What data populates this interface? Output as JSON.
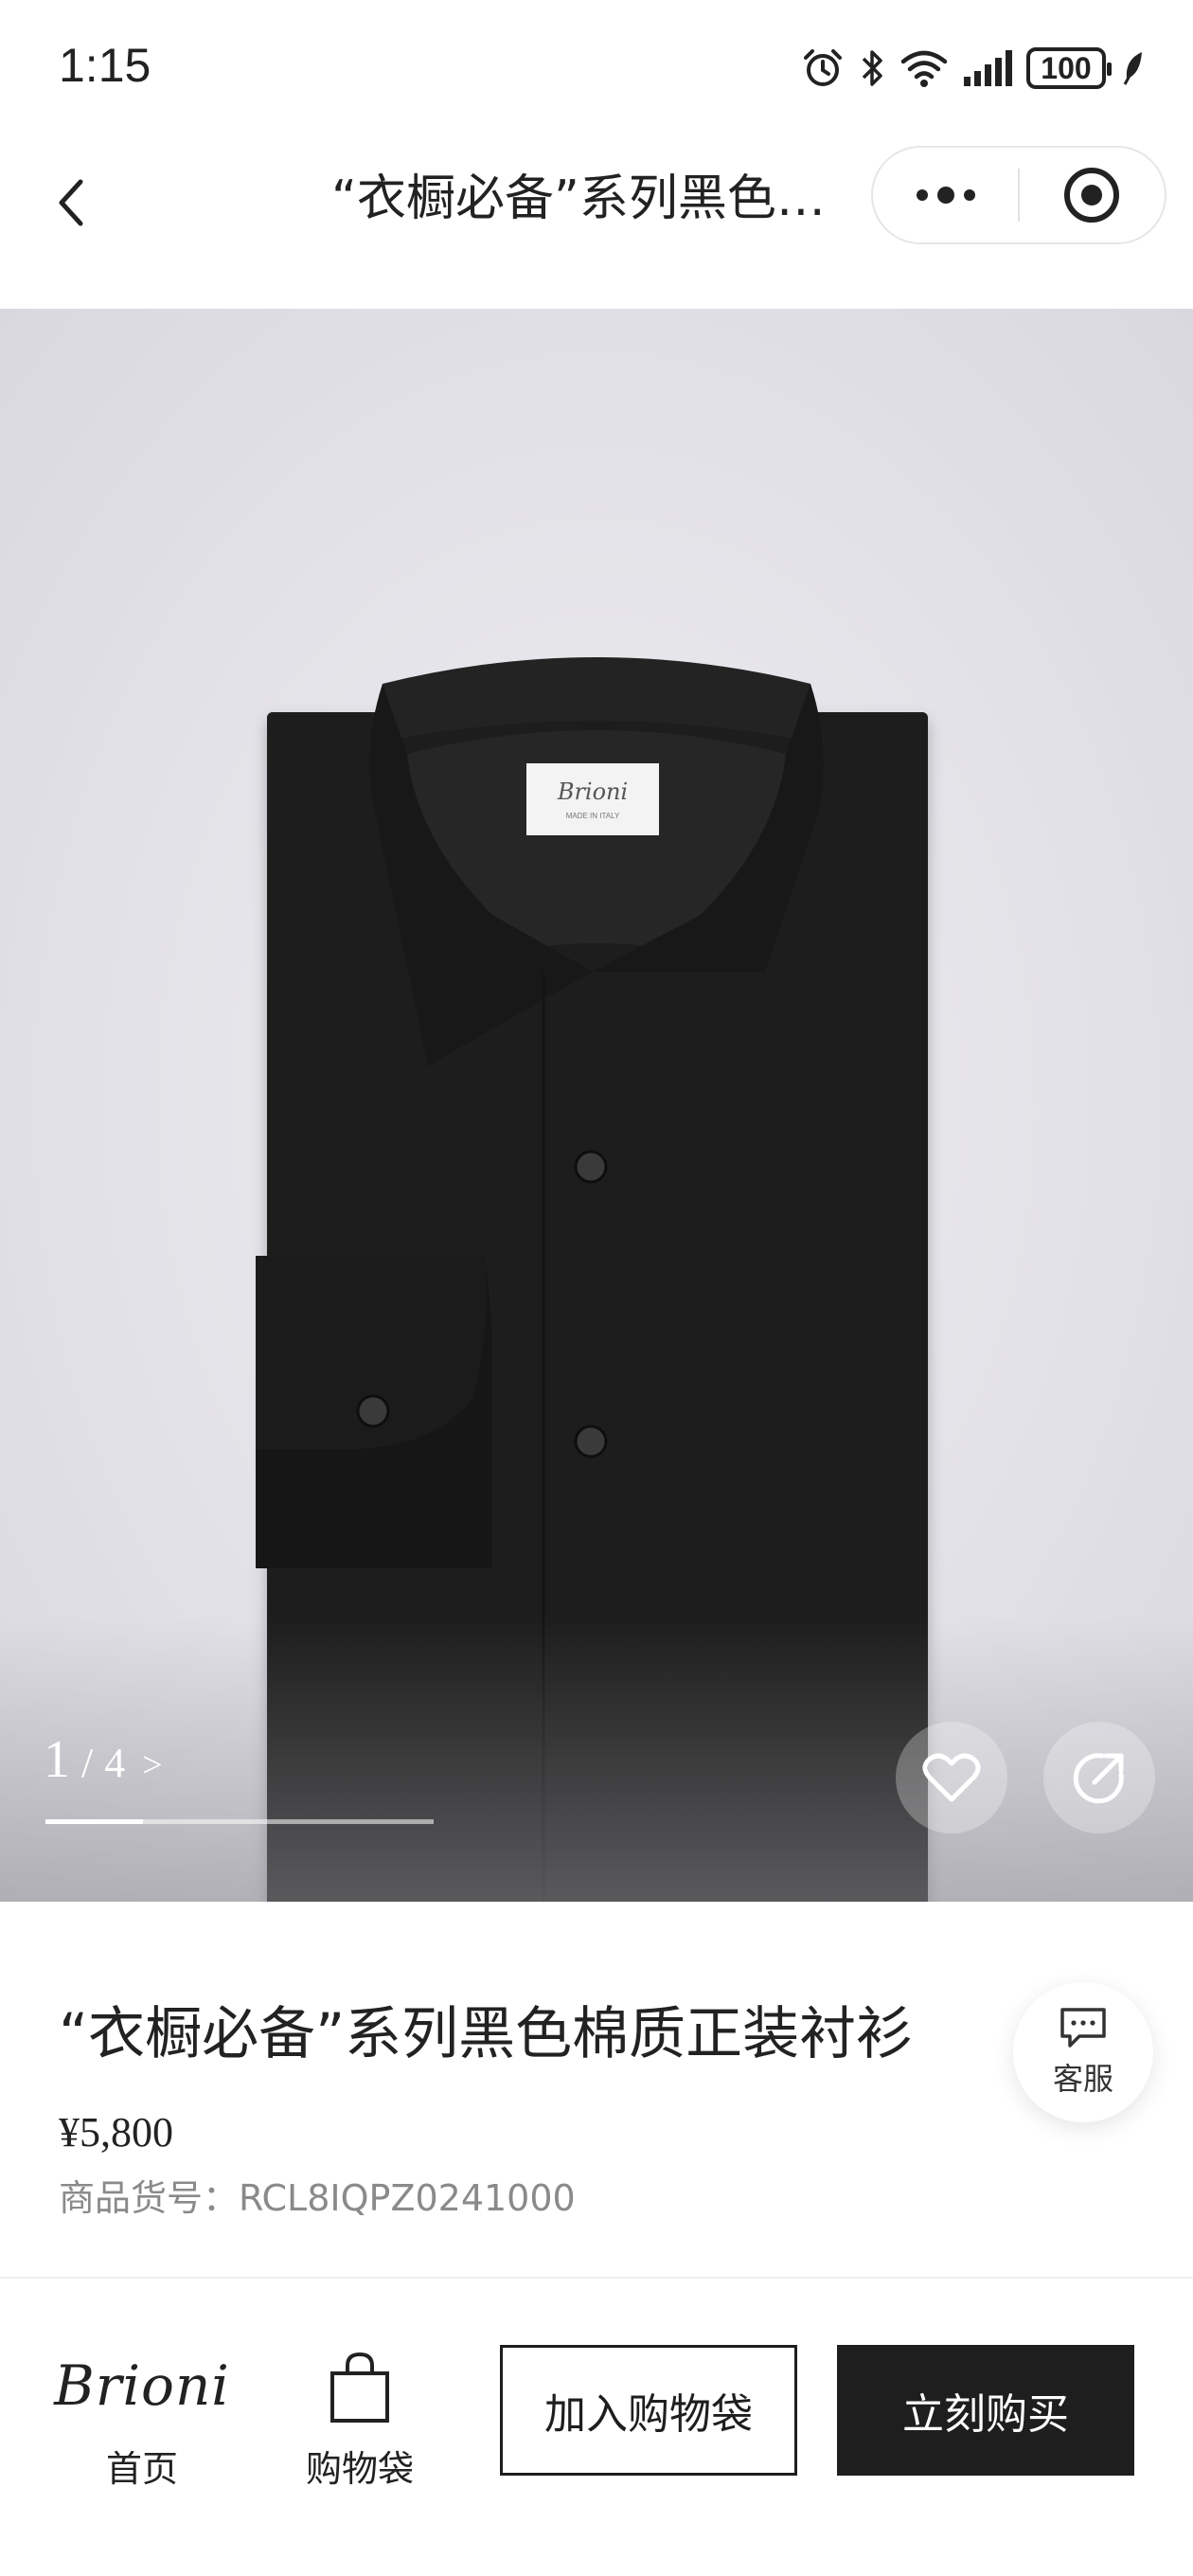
{
  "status_bar": {
    "time": "1:15",
    "battery": "100",
    "icons": [
      "alarm-icon",
      "bluetooth-icon",
      "wifi-icon",
      "signal-icon",
      "battery-icon",
      "leaf-icon"
    ]
  },
  "nav": {
    "title": "“衣橱必备”系列黑色棉质正装衬衫",
    "back_icon": "chevron-left-icon",
    "more_icon": "more-dots-icon",
    "close_icon": "target-icon"
  },
  "gallery": {
    "current": "1",
    "separator": "/",
    "total": "4",
    "next": ">",
    "progress_fraction": 0.25,
    "label_brand": "Brioni",
    "label_sub": "MADE IN ITALY"
  },
  "product": {
    "title": "“衣橱必备”系列黑色棉质正装衬衫",
    "price": "¥5,800",
    "sku_label": "商品货号：",
    "sku": "RCL8IQPZ0241000"
  },
  "customer_service": {
    "label": "客服"
  },
  "bottom_bar": {
    "brand_logo": "Brioni",
    "home_label": "首页",
    "bag_label": "购物袋",
    "add_to_bag": "加入购物袋",
    "buy_now": "立刻购买"
  },
  "colors": {
    "primary": "#1e1e1e",
    "background": "#ffffff",
    "muted_text": "#8a8a8a",
    "hero_bg": "#e2e1e7"
  }
}
